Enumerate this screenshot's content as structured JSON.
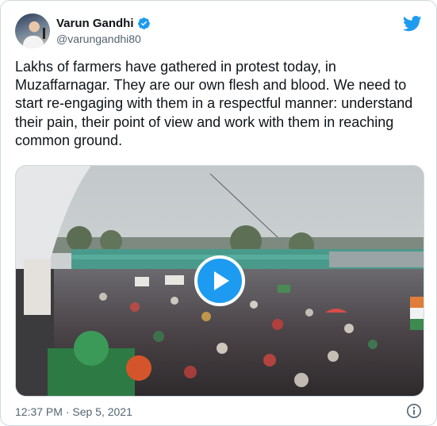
{
  "author": {
    "name": "Varun Gandhi",
    "handle": "@varungandhi80"
  },
  "tweet": {
    "text": "Lakhs of farmers have gathered in protest today, in Muzaffarnagar. They are our own flesh and blood. We need to start re-engaging with them in a respectful manner: understand their pain, their point of view and work with them in reaching common ground.",
    "timestamp": "12:37 PM · Sep 5, 2021"
  },
  "media": {
    "type": "video",
    "state": "paused"
  },
  "icons": {
    "verified": "verified-badge-icon",
    "brand": "twitter-bird-icon",
    "play": "play-icon",
    "info": "info-icon"
  },
  "colors": {
    "accent": "#1d9bf0",
    "text": "#0f1419",
    "secondary": "#536471",
    "border": "#cfd9de"
  }
}
